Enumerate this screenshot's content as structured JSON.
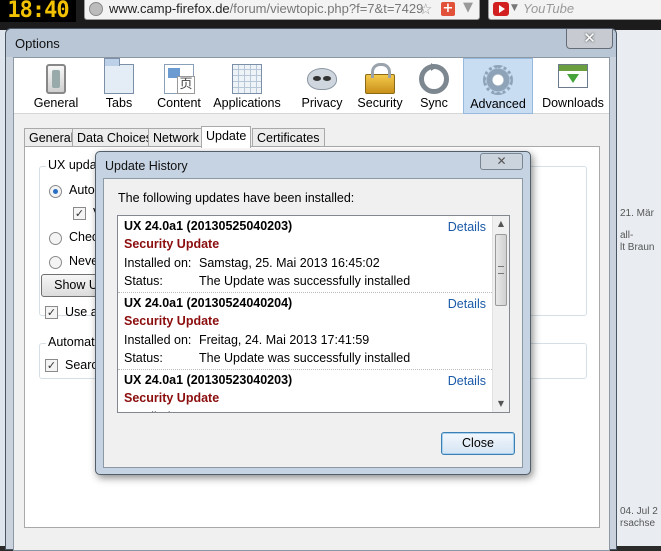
{
  "browser": {
    "clock": "18:40",
    "url_domain": "www.camp-firefox.de",
    "url_path": "/forum/viewtopic.php?f=7&t=7429",
    "search_placeholder": "YouTube",
    "right_page_snippets": [
      "21. Mär",
      "all-",
      "lt Braun",
      "04. Jul 2",
      "rsachse"
    ]
  },
  "options": {
    "title": "Options",
    "close_label": "✕",
    "panes": [
      {
        "label": "General",
        "icon": "switch-icon"
      },
      {
        "label": "Tabs",
        "icon": "tabs-icon"
      },
      {
        "label": "Content",
        "icon": "content-icon"
      },
      {
        "label": "Applications",
        "icon": "applications-icon"
      },
      {
        "label": "Privacy",
        "icon": "mask-icon"
      },
      {
        "label": "Security",
        "icon": "lock-icon"
      },
      {
        "label": "Sync",
        "icon": "sync-icon"
      },
      {
        "label": "Advanced",
        "icon": "gear-icon"
      },
      {
        "label": "Downloads",
        "icon": "download-icon"
      }
    ],
    "active_pane": "Advanced",
    "subtabs": [
      "General",
      "Data Choices",
      "Network",
      "Update",
      "Certificates"
    ],
    "active_subtab": "Update",
    "update_group_caption": "UX updat",
    "auto_option": "Auto",
    "auto_sub_check": "V",
    "check_option": "Chec",
    "never_option": "Neve",
    "show_button": "Show U",
    "use_option": "Use a",
    "automatic_caption": "Automati",
    "search_option": "Searc"
  },
  "dialog": {
    "title": "Update History",
    "close_label": "✕",
    "intro": "The following updates have been installed:",
    "details_label": "Details",
    "installed_on_label": "Installed on:",
    "status_label": "Status:",
    "entries": [
      {
        "name": "UX 24.0a1 (20130525040203)",
        "type": "Security Update",
        "installed_on": "Samstag, 25. Mai 2013 16:45:02",
        "status": "The Update was successfully installed"
      },
      {
        "name": "UX 24.0a1 (20130524040204)",
        "type": "Security Update",
        "installed_on": "Freitag, 24. Mai 2013 17:41:59",
        "status": "The Update was successfully installed"
      },
      {
        "name": "UX 24.0a1 (20130523040203)",
        "type": "Security Update",
        "installed_on": "",
        "status": ""
      }
    ],
    "close_button": "Close"
  }
}
